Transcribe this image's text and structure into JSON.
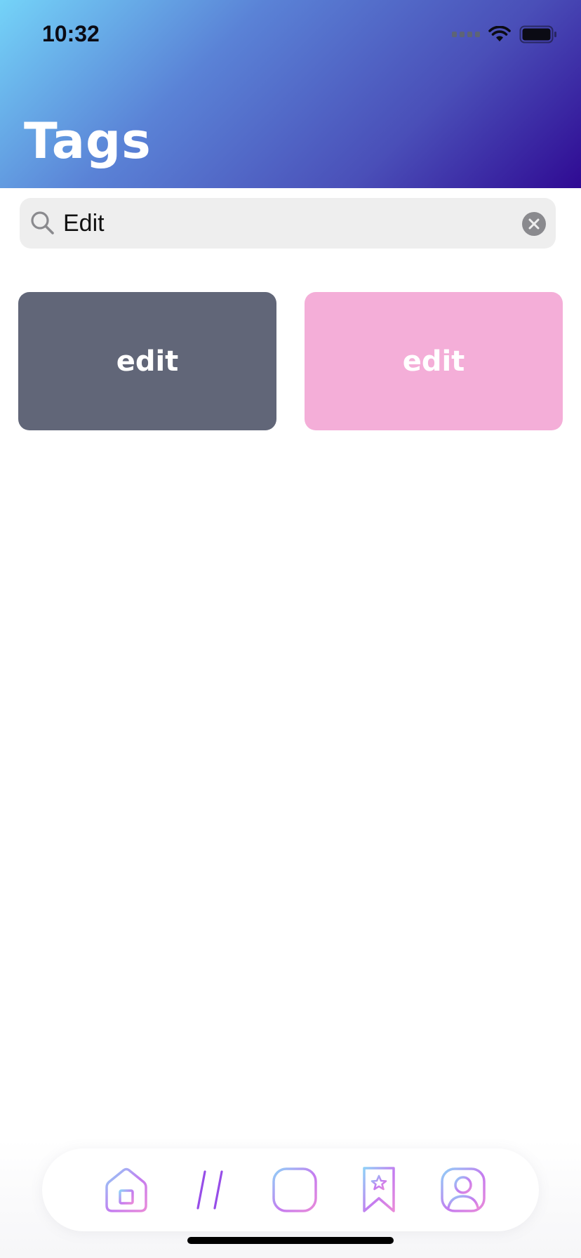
{
  "status_bar": {
    "time": "10:32"
  },
  "header": {
    "title": "Tags"
  },
  "search": {
    "value": "Edit",
    "placeholder": ""
  },
  "tags": [
    {
      "label": "edit",
      "color": "#616678"
    },
    {
      "label": "edit",
      "color": "#f4aed8"
    }
  ],
  "tab_bar": {
    "items": [
      {
        "icon": "home-icon"
      },
      {
        "icon": "hashtag-icon",
        "selected": true
      },
      {
        "icon": "add-icon"
      },
      {
        "icon": "bookmark-star-icon"
      },
      {
        "icon": "profile-icon"
      }
    ]
  },
  "colors": {
    "header_gradient": [
      "#74d3f8",
      "#5a82d6",
      "#4a4fb8",
      "#2f0a93"
    ],
    "icon_gradient": [
      "#8fd0f7",
      "#c47cf0",
      "#e98ad9"
    ]
  }
}
